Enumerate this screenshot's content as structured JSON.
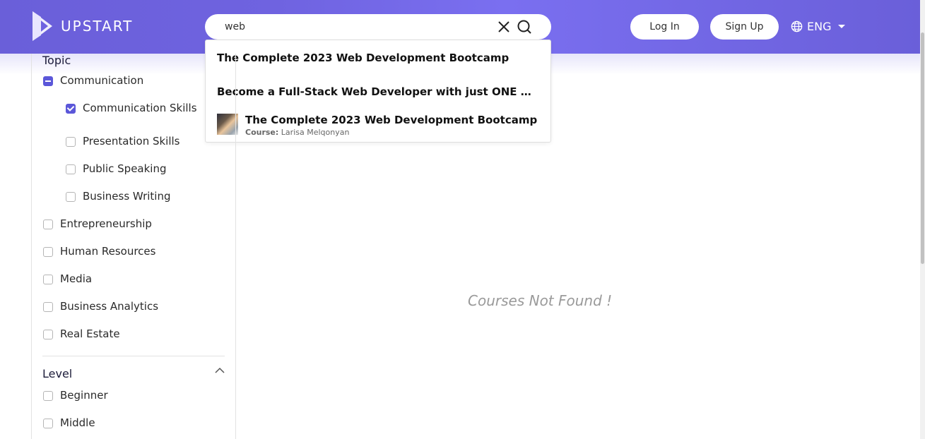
{
  "brand": {
    "name": "UPSTART"
  },
  "search": {
    "value": "web",
    "suggestions": [
      "The Complete 2023 Web Development Bootcamp",
      "Become a Full-Stack Web Developer with just ONE course"
    ],
    "course_result": {
      "title": "The Complete 2023 Web Development Bootcamp",
      "type_label": "Course:",
      "author": "Larisa Melqonyan"
    }
  },
  "header": {
    "login_label": "Log In",
    "signup_label": "Sign Up",
    "language": "ENG"
  },
  "filters": {
    "topic_title": "Topic",
    "topics": [
      {
        "label": "Communication",
        "state": "indeterminate"
      },
      {
        "label": "Communication Skills",
        "state": "checked"
      },
      {
        "label": "Presentation Skills",
        "state": "unchecked"
      },
      {
        "label": "Public Speaking",
        "state": "unchecked"
      },
      {
        "label": "Business Writing",
        "state": "unchecked"
      },
      {
        "label": "Entrepreneurship",
        "state": "unchecked"
      },
      {
        "label": "Human Resources",
        "state": "unchecked"
      },
      {
        "label": "Media",
        "state": "unchecked"
      },
      {
        "label": "Business Analytics",
        "state": "unchecked"
      },
      {
        "label": "Real Estate",
        "state": "unchecked"
      }
    ],
    "level_title": "Level",
    "levels": [
      {
        "label": "Beginner",
        "state": "unchecked"
      },
      {
        "label": "Middle",
        "state": "unchecked"
      }
    ]
  },
  "main": {
    "empty_message": "Courses Not Found !"
  },
  "colors": {
    "accent": "#5b57d9",
    "header": "#6f63e0"
  }
}
